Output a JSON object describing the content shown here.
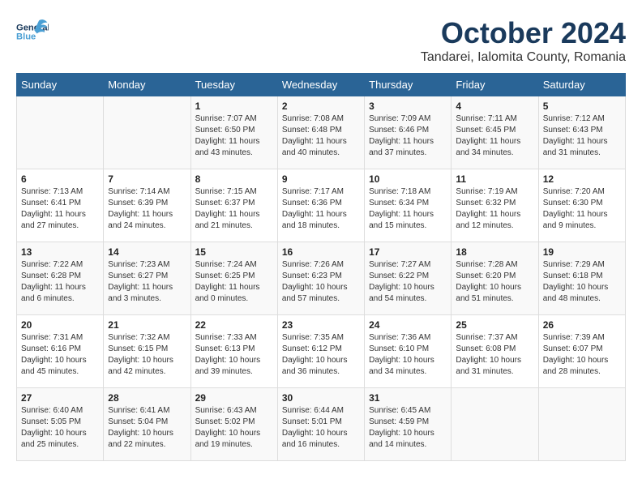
{
  "header": {
    "logo_general": "General",
    "logo_blue": "Blue",
    "month": "October 2024",
    "location": "Tandarei, Ialomita County, Romania"
  },
  "weekdays": [
    "Sunday",
    "Monday",
    "Tuesday",
    "Wednesday",
    "Thursday",
    "Friday",
    "Saturday"
  ],
  "weeks": [
    [
      {
        "day": "",
        "info": ""
      },
      {
        "day": "",
        "info": ""
      },
      {
        "day": "1",
        "info": "Sunrise: 7:07 AM\nSunset: 6:50 PM\nDaylight: 11 hours and 43 minutes."
      },
      {
        "day": "2",
        "info": "Sunrise: 7:08 AM\nSunset: 6:48 PM\nDaylight: 11 hours and 40 minutes."
      },
      {
        "day": "3",
        "info": "Sunrise: 7:09 AM\nSunset: 6:46 PM\nDaylight: 11 hours and 37 minutes."
      },
      {
        "day": "4",
        "info": "Sunrise: 7:11 AM\nSunset: 6:45 PM\nDaylight: 11 hours and 34 minutes."
      },
      {
        "day": "5",
        "info": "Sunrise: 7:12 AM\nSunset: 6:43 PM\nDaylight: 11 hours and 31 minutes."
      }
    ],
    [
      {
        "day": "6",
        "info": "Sunrise: 7:13 AM\nSunset: 6:41 PM\nDaylight: 11 hours and 27 minutes."
      },
      {
        "day": "7",
        "info": "Sunrise: 7:14 AM\nSunset: 6:39 PM\nDaylight: 11 hours and 24 minutes."
      },
      {
        "day": "8",
        "info": "Sunrise: 7:15 AM\nSunset: 6:37 PM\nDaylight: 11 hours and 21 minutes."
      },
      {
        "day": "9",
        "info": "Sunrise: 7:17 AM\nSunset: 6:36 PM\nDaylight: 11 hours and 18 minutes."
      },
      {
        "day": "10",
        "info": "Sunrise: 7:18 AM\nSunset: 6:34 PM\nDaylight: 11 hours and 15 minutes."
      },
      {
        "day": "11",
        "info": "Sunrise: 7:19 AM\nSunset: 6:32 PM\nDaylight: 11 hours and 12 minutes."
      },
      {
        "day": "12",
        "info": "Sunrise: 7:20 AM\nSunset: 6:30 PM\nDaylight: 11 hours and 9 minutes."
      }
    ],
    [
      {
        "day": "13",
        "info": "Sunrise: 7:22 AM\nSunset: 6:28 PM\nDaylight: 11 hours and 6 minutes."
      },
      {
        "day": "14",
        "info": "Sunrise: 7:23 AM\nSunset: 6:27 PM\nDaylight: 11 hours and 3 minutes."
      },
      {
        "day": "15",
        "info": "Sunrise: 7:24 AM\nSunset: 6:25 PM\nDaylight: 11 hours and 0 minutes."
      },
      {
        "day": "16",
        "info": "Sunrise: 7:26 AM\nSunset: 6:23 PM\nDaylight: 10 hours and 57 minutes."
      },
      {
        "day": "17",
        "info": "Sunrise: 7:27 AM\nSunset: 6:22 PM\nDaylight: 10 hours and 54 minutes."
      },
      {
        "day": "18",
        "info": "Sunrise: 7:28 AM\nSunset: 6:20 PM\nDaylight: 10 hours and 51 minutes."
      },
      {
        "day": "19",
        "info": "Sunrise: 7:29 AM\nSunset: 6:18 PM\nDaylight: 10 hours and 48 minutes."
      }
    ],
    [
      {
        "day": "20",
        "info": "Sunrise: 7:31 AM\nSunset: 6:16 PM\nDaylight: 10 hours and 45 minutes."
      },
      {
        "day": "21",
        "info": "Sunrise: 7:32 AM\nSunset: 6:15 PM\nDaylight: 10 hours and 42 minutes."
      },
      {
        "day": "22",
        "info": "Sunrise: 7:33 AM\nSunset: 6:13 PM\nDaylight: 10 hours and 39 minutes."
      },
      {
        "day": "23",
        "info": "Sunrise: 7:35 AM\nSunset: 6:12 PM\nDaylight: 10 hours and 36 minutes."
      },
      {
        "day": "24",
        "info": "Sunrise: 7:36 AM\nSunset: 6:10 PM\nDaylight: 10 hours and 34 minutes."
      },
      {
        "day": "25",
        "info": "Sunrise: 7:37 AM\nSunset: 6:08 PM\nDaylight: 10 hours and 31 minutes."
      },
      {
        "day": "26",
        "info": "Sunrise: 7:39 AM\nSunset: 6:07 PM\nDaylight: 10 hours and 28 minutes."
      }
    ],
    [
      {
        "day": "27",
        "info": "Sunrise: 6:40 AM\nSunset: 5:05 PM\nDaylight: 10 hours and 25 minutes."
      },
      {
        "day": "28",
        "info": "Sunrise: 6:41 AM\nSunset: 5:04 PM\nDaylight: 10 hours and 22 minutes."
      },
      {
        "day": "29",
        "info": "Sunrise: 6:43 AM\nSunset: 5:02 PM\nDaylight: 10 hours and 19 minutes."
      },
      {
        "day": "30",
        "info": "Sunrise: 6:44 AM\nSunset: 5:01 PM\nDaylight: 10 hours and 16 minutes."
      },
      {
        "day": "31",
        "info": "Sunrise: 6:45 AM\nSunset: 4:59 PM\nDaylight: 10 hours and 14 minutes."
      },
      {
        "day": "",
        "info": ""
      },
      {
        "day": "",
        "info": ""
      }
    ]
  ]
}
